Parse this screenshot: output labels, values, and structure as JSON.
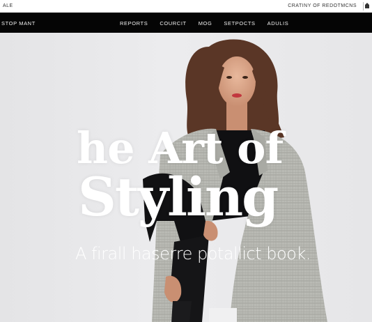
{
  "topbar": {
    "left_text": "ALE",
    "right_text": "CRATINY OF REDOTMCNS"
  },
  "navbar": {
    "brand": "STOP MANT",
    "links": [
      "REPORTS",
      "COURCIT",
      "MOG",
      "SETPOCTS",
      "ADULIS"
    ]
  },
  "hero": {
    "title_line1": "he Art of",
    "title_line2": "Styling",
    "subtitle": "A firall haserre potallict book."
  },
  "icons": {
    "home": "home-icon"
  }
}
